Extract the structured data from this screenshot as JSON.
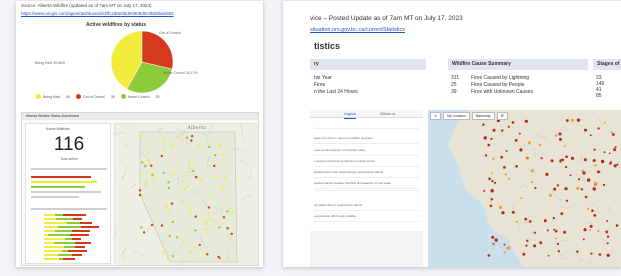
{
  "left_card": {
    "source_note": "Source: Alberta Wildfire (updated as of 7am MT on July 17, 2023)",
    "source_link": "https://www.arcgis.com/apps/dashboards/3ffc2d8e0bde0908d0c0bb0bdeb62",
    "chart_title": "Active wildfires by status",
    "pie_labels": {
      "being_held": "Being Held 39.66%",
      "under_control": "Under Control 30.17%",
      "out_of_control": "Out of Control"
    },
    "legend": [
      "Being Held",
      "46",
      "Out of Control",
      "39",
      "Under Control",
      "35"
    ],
    "colors": {
      "being_held": "#f2ec3c",
      "out_of_control": "#d63a1e",
      "under_control": "#8ccb3a"
    },
    "dashboard": {
      "header": "Alberta Wildfire Status Dashboard",
      "count_label": "Active Wildfires",
      "count_value": "116",
      "count_sub": "Total active",
      "map_label": "Alberta"
    }
  },
  "right_card": {
    "title": "vice – Posted Update as of 7am MT on July 17, 2023",
    "link": "situation.nrs.gov.bc.ca/currentStatistics",
    "heading": "tistics",
    "section_left": "ry",
    "left_rows": [
      "his Year",
      "Fires",
      "n the Last 24 Hours"
    ],
    "section_cause": "Wildfire Cause Summary",
    "cause_rows": [
      {
        "count": "311",
        "label": "Fires Caused by Lightning"
      },
      {
        "count": "25",
        "label": "Fires Caused by People"
      },
      {
        "count": "39",
        "label": "Fires with Unknown Causes"
      }
    ],
    "section_stages": "Stages of",
    "stage_values": [
      "23",
      "149",
      "41",
      "85"
    ],
    "tabs": {
      "legend": "Legend",
      "about": "Stikine ca."
    },
    "list_rows": [
      "...",
      "ages of control to report on wildfire progress.",
      "s are predominantly in Columbia valley",
      "s ground crews being effective in rapid control",
      "ignated due to fire responding to suppression efforts",
      "predominantly between foothills and weather of vast scale",
      "",
      "ng further due to suppression efforts",
      "suppression efforts are suitable"
    ],
    "map_toolbar": [
      "✕",
      "My Location",
      "Basemap",
      "☰"
    ]
  }
}
